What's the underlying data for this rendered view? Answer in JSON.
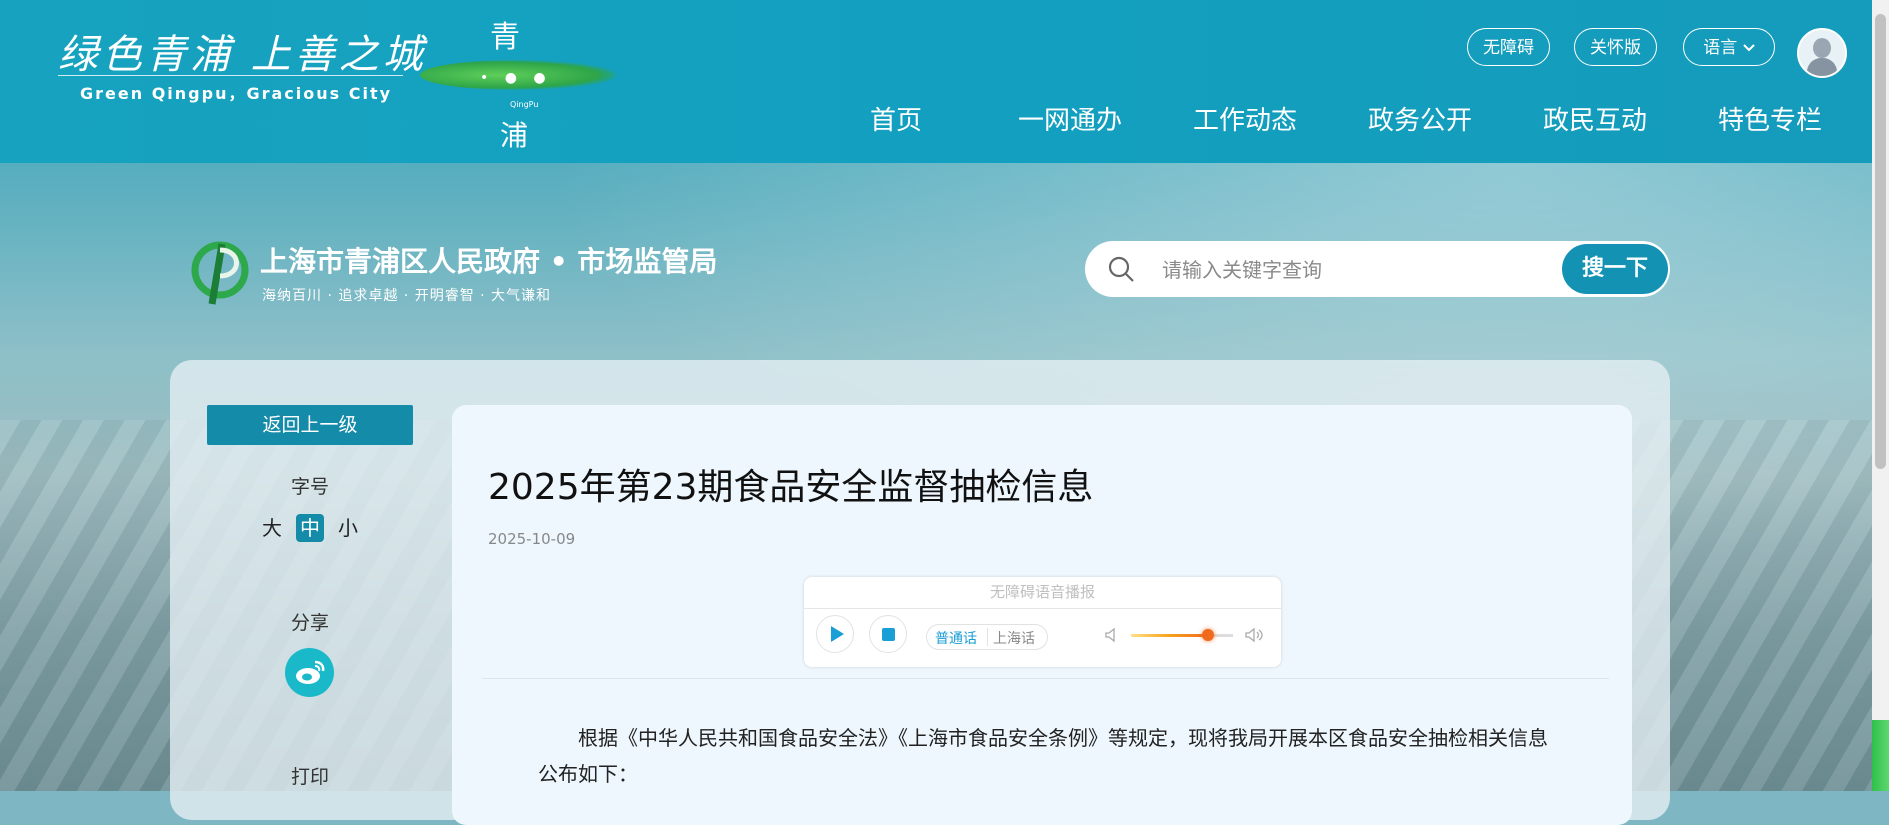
{
  "header": {
    "slogan_cn": "绿色青浦  上善之城",
    "slogan_en": "Green  Qingpu，Gracious City",
    "qingpu_logo": {
      "top_char": "青",
      "bottom_char": "浦",
      "small_text": "QingPu"
    },
    "tools": {
      "accessibility": "无障碍",
      "elder_mode": "关怀版",
      "language": "语言"
    },
    "nav": [
      "首页",
      "一网通办",
      "工作动态",
      "政务公开",
      "政民互动",
      "特色专栏"
    ]
  },
  "site": {
    "title": "上海市青浦区人民政府 • 市场监管局",
    "motto": "海纳百川 · 追求卓越 · 开明睿智 · 大气谦和"
  },
  "search": {
    "placeholder": "请输入关键字查询",
    "button": "搜一下"
  },
  "sidebar": {
    "back": "返回上一级",
    "font_label": "字号",
    "font_sizes": [
      "大",
      "中",
      "小"
    ],
    "share_label": "分享",
    "print_label": "打印"
  },
  "article": {
    "title": "2025年第23期食品安全监督抽检信息",
    "date": "2025-10-09",
    "player": {
      "title": "无障碍语音播报",
      "dialect_on": "普通话",
      "dialect_off": "上海话",
      "volume": 0.75
    },
    "body": "根据《中华人民共和国食品安全法》《上海市食品安全条例》等规定，现将我局开展本区食品安全抽检相关信息公布如下："
  },
  "colors": {
    "primary": "#148ba8",
    "header": "#17a3bf",
    "accent": "#1a9ed6"
  }
}
